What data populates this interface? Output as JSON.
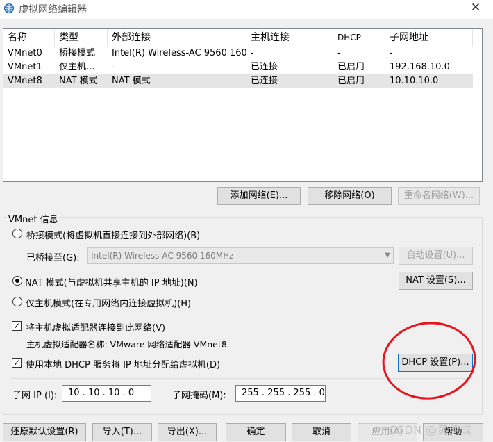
{
  "window": {
    "title": "虚拟网络编辑器"
  },
  "table": {
    "columns": [
      "名称",
      "类型",
      "外部连接",
      "主机连接",
      "DHCP",
      "子网地址"
    ],
    "rows": [
      {
        "name": "VMnet0",
        "type": "桥接模式",
        "external": "Intel(R) Wireless-AC 9560 160...",
        "host": "-",
        "dhcp": "-",
        "subnet": "-"
      },
      {
        "name": "VMnet1",
        "type": "仅主机...",
        "external": "-",
        "host": "已连接",
        "dhcp": "已启用",
        "subnet": "192.168.10.0"
      },
      {
        "name": "VMnet8",
        "type": "NAT 模式",
        "external": "NAT 模式",
        "host": "已连接",
        "dhcp": "已启用",
        "subnet": "10.10.10.0"
      }
    ],
    "selected_row": 2
  },
  "table_buttons": {
    "add": "添加网络(E)...",
    "remove": "移除网络(O)",
    "rename": "重命名网络(W)..."
  },
  "vmnet_info": {
    "group_title": "VMnet 信息",
    "bridge_label": "桥接模式(将虚拟机直接连接到外部网络)(B)",
    "bridged_to_label": "已桥接至(G):",
    "bridged_to_value": "Intel(R) Wireless-AC 9560 160MHz",
    "auto_settings": "自动设置(U)...",
    "nat_label": "NAT 模式(与虚拟机共享主机的 IP 地址)(N)",
    "nat_settings": "NAT 设置(S)...",
    "hostonly_label": "仅主机模式(在专用网络内连接虚拟机)(H)",
    "connect_adapter_label": "将主机虚拟适配器连接到此网络(V)",
    "adapter_name_label": "主机虚拟适配器名称: VMware 网络适配器 VMnet8",
    "dhcp_label": "使用本地 DHCP 服务将 IP 地址分配给虚拟机(D)",
    "dhcp_settings": "DHCP 设置(P)...",
    "subnet_ip_label": "子网 IP (I):",
    "subnet_ip_value": "10 . 10 . 10 . 0",
    "subnet_mask_label": "子网掩码(M):",
    "subnet_mask_value": "255 . 255 . 255 . 0",
    "mode": "nat",
    "connect_adapter_checked": true,
    "dhcp_checked": true
  },
  "footer_buttons": {
    "restore_defaults": "还原默认设置(R)",
    "import": "导入(T)...",
    "export": "导出(X)...",
    "ok": "确定",
    "cancel": "取消",
    "apply": "应用(A)",
    "help": "帮助"
  },
  "watermark": "CSDN @黄伊成",
  "colors": {
    "annotation": "#e8141c",
    "window_bg": "#f0f0f0",
    "selected_row": "#e5e5e5"
  },
  "icons": {
    "app": "network-editor-icon",
    "close": "close-icon"
  }
}
